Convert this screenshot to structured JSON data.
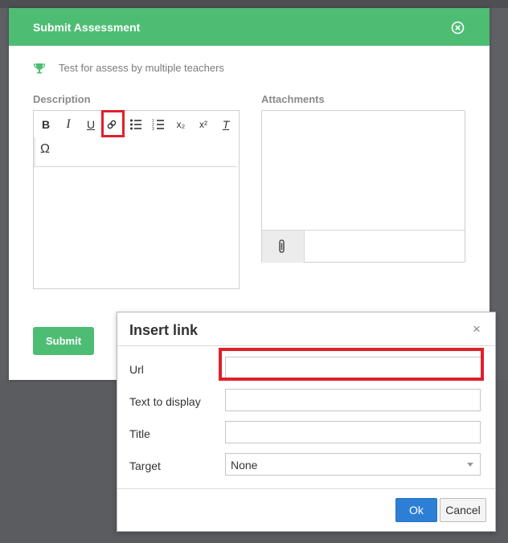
{
  "modal": {
    "title": "Submit Assessment",
    "assessment_name": "Test for assess by multiple teachers",
    "description_label": "Description",
    "attachments_label": "Attachments",
    "submit_label": "Submit"
  },
  "editor": {
    "toolbar": [
      {
        "name": "bold-button",
        "glyph": "B"
      },
      {
        "name": "italic-button",
        "glyph": "I"
      },
      {
        "name": "underline-button",
        "glyph": "U"
      },
      {
        "name": "link-button",
        "glyph": "link-icon"
      },
      {
        "name": "bullet-list-button",
        "glyph": "bullet-list-icon"
      },
      {
        "name": "numbered-list-button",
        "glyph": "numbered-list-icon"
      },
      {
        "name": "subscript-button",
        "glyph": "x₂"
      },
      {
        "name": "superscript-button",
        "glyph": "x²"
      },
      {
        "name": "clear-format-button",
        "glyph": "T"
      }
    ],
    "special_char": "Ω"
  },
  "dialog": {
    "title": "Insert link",
    "close_glyph": "×",
    "fields": {
      "url_label": "Url",
      "url_value": "",
      "text_label": "Text to display",
      "text_value": "",
      "title_label": "Title",
      "title_value": "",
      "target_label": "Target",
      "target_value": "None"
    },
    "ok_label": "Ok",
    "cancel_label": "Cancel"
  },
  "colors": {
    "header_green": "#4ebd74",
    "highlight_red": "#e0202a",
    "ok_blue": "#2d7fd6"
  }
}
